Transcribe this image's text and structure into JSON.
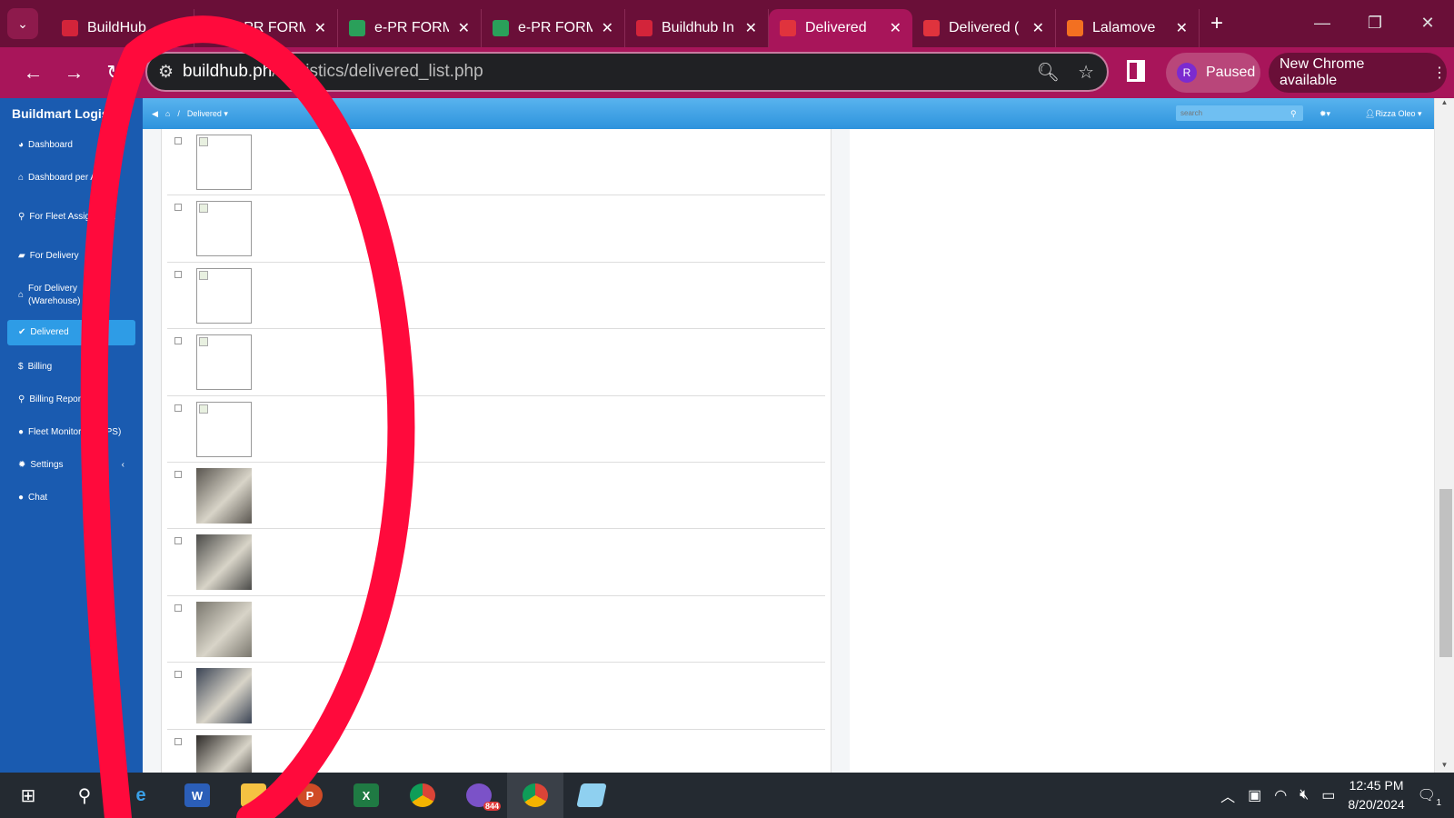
{
  "browser": {
    "tabs": [
      {
        "title": "BuildHub",
        "favicon": "#d3243a"
      },
      {
        "title": "e-PR FORM",
        "favicon": "#2aa05a"
      },
      {
        "title": "e-PR FORM",
        "favicon": "#2aa05a"
      },
      {
        "title": "e-PR FORM",
        "favicon": "#2aa05a"
      },
      {
        "title": "Buildhub In",
        "favicon": "#d3243a"
      },
      {
        "title": "Delivered",
        "favicon": "#e0333d",
        "active": true
      },
      {
        "title": "Delivered (",
        "favicon": "#e0333d"
      },
      {
        "title": "Lalamove",
        "favicon": "#f37021"
      }
    ],
    "url_host": "buildhub.ph",
    "url_path": "/Logistics/delivered_list.php",
    "profile_initial": "R",
    "profile_status": "Paused",
    "update_label": "New Chrome available"
  },
  "app": {
    "brand": "Buildmart Logistics",
    "menu": [
      {
        "icon": "pie-chart-icon",
        "glyph": "◕",
        "label": "Dashboard"
      },
      {
        "icon": "home-icon",
        "glyph": "⌂",
        "label": "Dashboard per Area"
      },
      {
        "icon": "motorcycle-icon",
        "glyph": "⚲",
        "label": "For Fleet Assignment"
      },
      {
        "icon": "truck-icon",
        "glyph": "▰",
        "label": "For Delivery"
      },
      {
        "icon": "home-icon",
        "glyph": "⌂",
        "label": "For Delivery (Warehouse)"
      },
      {
        "icon": "check-icon",
        "glyph": "✔",
        "label": "Delivered",
        "active": true
      },
      {
        "icon": "dollar-icon",
        "glyph": "$",
        "label": "Billing"
      },
      {
        "icon": "search-icon",
        "glyph": "⚲",
        "label": "Billing Report"
      },
      {
        "icon": "map-pin-icon",
        "glyph": "●",
        "label": "Fleet Monitoring (GPS)"
      },
      {
        "icon": "gear-icon",
        "glyph": "✹",
        "label": "Settings",
        "chevron": "‹"
      },
      {
        "icon": "chat-icon",
        "glyph": "●",
        "label": "Chat"
      }
    ],
    "breadcrumb": "Delivered",
    "search_placeholder": "search",
    "user": "Rizza Oleo"
  },
  "rows": [
    {
      "image": "broken"
    },
    {
      "image": "broken"
    },
    {
      "image": "broken"
    },
    {
      "image": "broken"
    },
    {
      "image": "broken"
    },
    {
      "image": "photo",
      "tone": "#5a5650"
    },
    {
      "image": "photo",
      "tone": "#4a4a48"
    },
    {
      "image": "photo",
      "tone": "#7a776e"
    },
    {
      "image": "photo",
      "tone": "#3b4455"
    },
    {
      "image": "photo",
      "tone": "#2d2a28"
    }
  ],
  "taskbar": {
    "viber_badge": "844",
    "time": "12:45 PM",
    "date": "8/20/2024",
    "notifications": "1"
  },
  "colors": {
    "annotation": "#ff0a3c",
    "sidebar": "#1a5bb0",
    "tabbar": "#6a0f38"
  }
}
